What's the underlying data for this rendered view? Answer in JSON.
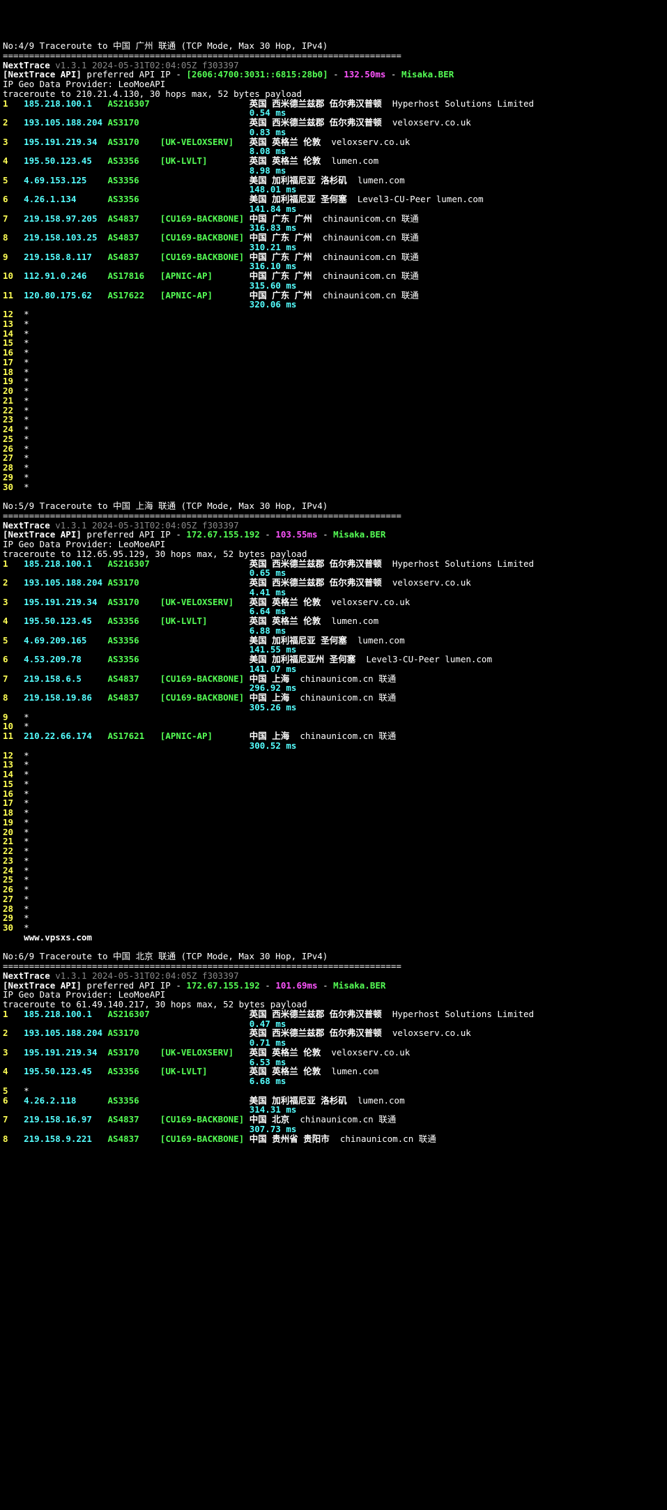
{
  "blocks": [
    {
      "header": "No:4/9 Traceroute to 中国 广州 联通 (TCP Mode, Max 30 Hop, IPv4)",
      "sep": "============================================================================",
      "nexttrace": "NextTrace",
      "version": " v1.3.1 2024-05-31T02:04:05Z f303397",
      "api_label": "[NextTrace API]",
      "api_text": " preferred API IP - ",
      "api_ip": "[2606:4700:3031::6815:28b0]",
      "api_sep": " - ",
      "api_lat": "132.50ms",
      "api_sep2": " - ",
      "api_node": "Misaka.BER",
      "geo": "IP Geo Data Provider: LeoMoeAPI",
      "traceline": "traceroute to 210.21.4.130, 30 hops max, 52 bytes payload",
      "hops": [
        {
          "n": "1",
          "ip": "185.218.100.1",
          "asn": "AS216307",
          "tag": "",
          "loc": "英国 西米德兰兹郡 伍尔弗汉普顿",
          "host": "Hyperhost Solutions Limited",
          "lat": "0.54 ms"
        },
        {
          "n": "2",
          "ip": "193.105.188.204",
          "asn": "AS3170",
          "tag": "",
          "loc": "英国 西米德兰兹郡 伍尔弗汉普顿",
          "host": "veloxserv.co.uk",
          "lat": "0.83 ms"
        },
        {
          "n": "3",
          "ip": "195.191.219.34",
          "asn": "AS3170",
          "tag": "[UK-VELOXSERV]",
          "loc": "英国 英格兰 伦敦",
          "host": "veloxserv.co.uk",
          "lat": "8.08 ms"
        },
        {
          "n": "4",
          "ip": "195.50.123.45",
          "asn": "AS3356",
          "tag": "[UK-LVLT]",
          "loc": "英国 英格兰 伦敦",
          "host": "lumen.com",
          "lat": "8.98 ms"
        },
        {
          "n": "5",
          "ip": "4.69.153.125",
          "asn": "AS3356",
          "tag": "",
          "loc": "美国 加利福尼亚 洛杉矶",
          "host": "lumen.com",
          "lat": "148.01 ms"
        },
        {
          "n": "6",
          "ip": "4.26.1.134",
          "asn": "AS3356",
          "tag": "",
          "loc": "美国 加利福尼亚 圣何塞",
          "host": "Level3-CU-Peer",
          "host2": "lumen.com",
          "lat": "141.84 ms"
        },
        {
          "n": "7",
          "ip": "219.158.97.205",
          "asn": "AS4837",
          "tag": "[CU169-BACKBONE]",
          "loc": "中国 广东 广州",
          "host": "chinaunicom.cn",
          "host2": "联通",
          "lat": "316.83 ms"
        },
        {
          "n": "8",
          "ip": "219.158.103.25",
          "asn": "AS4837",
          "tag": "[CU169-BACKBONE]",
          "loc": "中国 广东 广州",
          "host": "chinaunicom.cn",
          "host2": "联通",
          "lat": "310.21 ms"
        },
        {
          "n": "9",
          "ip": "219.158.8.117",
          "asn": "AS4837",
          "tag": "[CU169-BACKBONE]",
          "loc": "中国 广东 广州",
          "host": "chinaunicom.cn",
          "host2": "联通",
          "lat": "316.10 ms"
        },
        {
          "n": "10",
          "ip": "112.91.0.246",
          "asn": "AS17816",
          "tag": "[APNIC-AP]",
          "loc": "中国 广东 广州",
          "host": "chinaunicom.cn",
          "host2": "联通",
          "lat": "315.60 ms"
        },
        {
          "n": "11",
          "ip": "120.80.175.62",
          "asn": "AS17622",
          "tag": "[APNIC-AP]",
          "loc": "中国 广东 广州",
          "host": "chinaunicom.cn",
          "host2": "联通",
          "lat": "320.06 ms"
        }
      ],
      "star_start": 12,
      "star_end": 30
    },
    {
      "header": "No:5/9 Traceroute to 中国 上海 联通 (TCP Mode, Max 30 Hop, IPv4)",
      "sep": "============================================================================",
      "nexttrace": "NextTrace",
      "version": " v1.3.1 2024-05-31T02:04:05Z f303397",
      "api_label": "[NextTrace API]",
      "api_text": " preferred API IP - ",
      "api_ip": "172.67.155.192",
      "api_sep": " - ",
      "api_lat": "103.55ms",
      "api_sep2": " - ",
      "api_node": "Misaka.BER",
      "geo": "IP Geo Data Provider: LeoMoeAPI",
      "traceline": "traceroute to 112.65.95.129, 30 hops max, 52 bytes payload",
      "hops": [
        {
          "n": "1",
          "ip": "185.218.100.1",
          "asn": "AS216307",
          "tag": "",
          "loc": "英国 西米德兰兹郡 伍尔弗汉普顿",
          "host": "Hyperhost Solutions Limited",
          "lat": "0.65 ms"
        },
        {
          "n": "2",
          "ip": "193.105.188.204",
          "asn": "AS3170",
          "tag": "",
          "loc": "英国 西米德兰兹郡 伍尔弗汉普顿",
          "host": "veloxserv.co.uk",
          "lat": "4.41 ms"
        },
        {
          "n": "3",
          "ip": "195.191.219.34",
          "asn": "AS3170",
          "tag": "[UK-VELOXSERV]",
          "loc": "英国 英格兰 伦敦",
          "host": "veloxserv.co.uk",
          "lat": "6.64 ms"
        },
        {
          "n": "4",
          "ip": "195.50.123.45",
          "asn": "AS3356",
          "tag": "[UK-LVLT]",
          "loc": "英国 英格兰 伦敦",
          "host": "lumen.com",
          "lat": "6.88 ms"
        },
        {
          "n": "5",
          "ip": "4.69.209.165",
          "asn": "AS3356",
          "tag": "",
          "loc": "美国 加利福尼亚 圣何塞",
          "host": "lumen.com",
          "lat": "141.55 ms"
        },
        {
          "n": "6",
          "ip": "4.53.209.78",
          "asn": "AS3356",
          "tag": "",
          "loc": "美国 加利福尼亚州 圣何塞",
          "host": "Level3-CU-Peer",
          "host2": "lumen.com",
          "lat": "141.07 ms"
        },
        {
          "n": "7",
          "ip": "219.158.6.5",
          "asn": "AS4837",
          "tag": "[CU169-BACKBONE]",
          "loc": "中国 上海",
          "host": "chinaunicom.cn",
          "host2": "联通",
          "lat": "296.92 ms"
        },
        {
          "n": "8",
          "ip": "219.158.19.86",
          "asn": "AS4837",
          "tag": "[CU169-BACKBONE]",
          "loc": "中国 上海",
          "host": "chinaunicom.cn",
          "host2": "联通",
          "lat": "305.26 ms"
        }
      ],
      "stars_inline": [
        "9",
        "10"
      ],
      "hops2": [
        {
          "n": "11",
          "ip": "210.22.66.174",
          "asn": "AS17621",
          "tag": "[APNIC-AP]",
          "loc": "中国 上海",
          "host": "chinaunicom.cn",
          "host2": "联通",
          "lat": "300.52 ms"
        }
      ],
      "star_start": 12,
      "star_end": 30,
      "watermark": "    www.vpsxs.com"
    },
    {
      "header": "No:6/9 Traceroute to 中国 北京 联通 (TCP Mode, Max 30 Hop, IPv4)",
      "sep": "============================================================================",
      "nexttrace": "NextTrace",
      "version": " v1.3.1 2024-05-31T02:04:05Z f303397",
      "api_label": "[NextTrace API]",
      "api_text": " preferred API IP - ",
      "api_ip": "172.67.155.192",
      "api_sep": " - ",
      "api_lat": "101.69ms",
      "api_sep2": " - ",
      "api_node": "Misaka.BER",
      "geo": "IP Geo Data Provider: LeoMoeAPI",
      "traceline": "traceroute to 61.49.140.217, 30 hops max, 52 bytes payload",
      "hops": [
        {
          "n": "1",
          "ip": "185.218.100.1",
          "asn": "AS216307",
          "tag": "",
          "loc": "英国 西米德兰兹郡 伍尔弗汉普顿",
          "host": "Hyperhost Solutions Limited",
          "lat": "0.47 ms"
        },
        {
          "n": "2",
          "ip": "193.105.188.204",
          "asn": "AS3170",
          "tag": "",
          "loc": "英国 西米德兰兹郡 伍尔弗汉普顿",
          "host": "veloxserv.co.uk",
          "lat": "0.71 ms"
        },
        {
          "n": "3",
          "ip": "195.191.219.34",
          "asn": "AS3170",
          "tag": "[UK-VELOXSERV]",
          "loc": "英国 英格兰 伦敦",
          "host": "veloxserv.co.uk",
          "lat": "6.53 ms"
        },
        {
          "n": "4",
          "ip": "195.50.123.45",
          "asn": "AS3356",
          "tag": "[UK-LVLT]",
          "loc": "英国 英格兰 伦敦",
          "host": "lumen.com",
          "lat": "6.68 ms"
        }
      ],
      "stars_inline": [
        "5"
      ],
      "hops2": [
        {
          "n": "6",
          "ip": "4.26.2.118",
          "asn": "AS3356",
          "tag": "",
          "loc": "美国 加利福尼亚 洛杉矶",
          "host": "lumen.com",
          "lat": "314.31 ms"
        },
        {
          "n": "7",
          "ip": "219.158.16.97",
          "asn": "AS4837",
          "tag": "[CU169-BACKBONE]",
          "loc": "中国 北京",
          "host": "chinaunicom.cn",
          "host2": "联通",
          "lat": "307.73 ms"
        },
        {
          "n": "8",
          "ip": "219.158.9.221",
          "asn": "AS4837",
          "tag": "[CU169-BACKBONE]",
          "loc": "中国 贵州省 贵阳市",
          "host": "chinaunicom.cn",
          "host2": "联通",
          "lat": ""
        }
      ]
    }
  ]
}
